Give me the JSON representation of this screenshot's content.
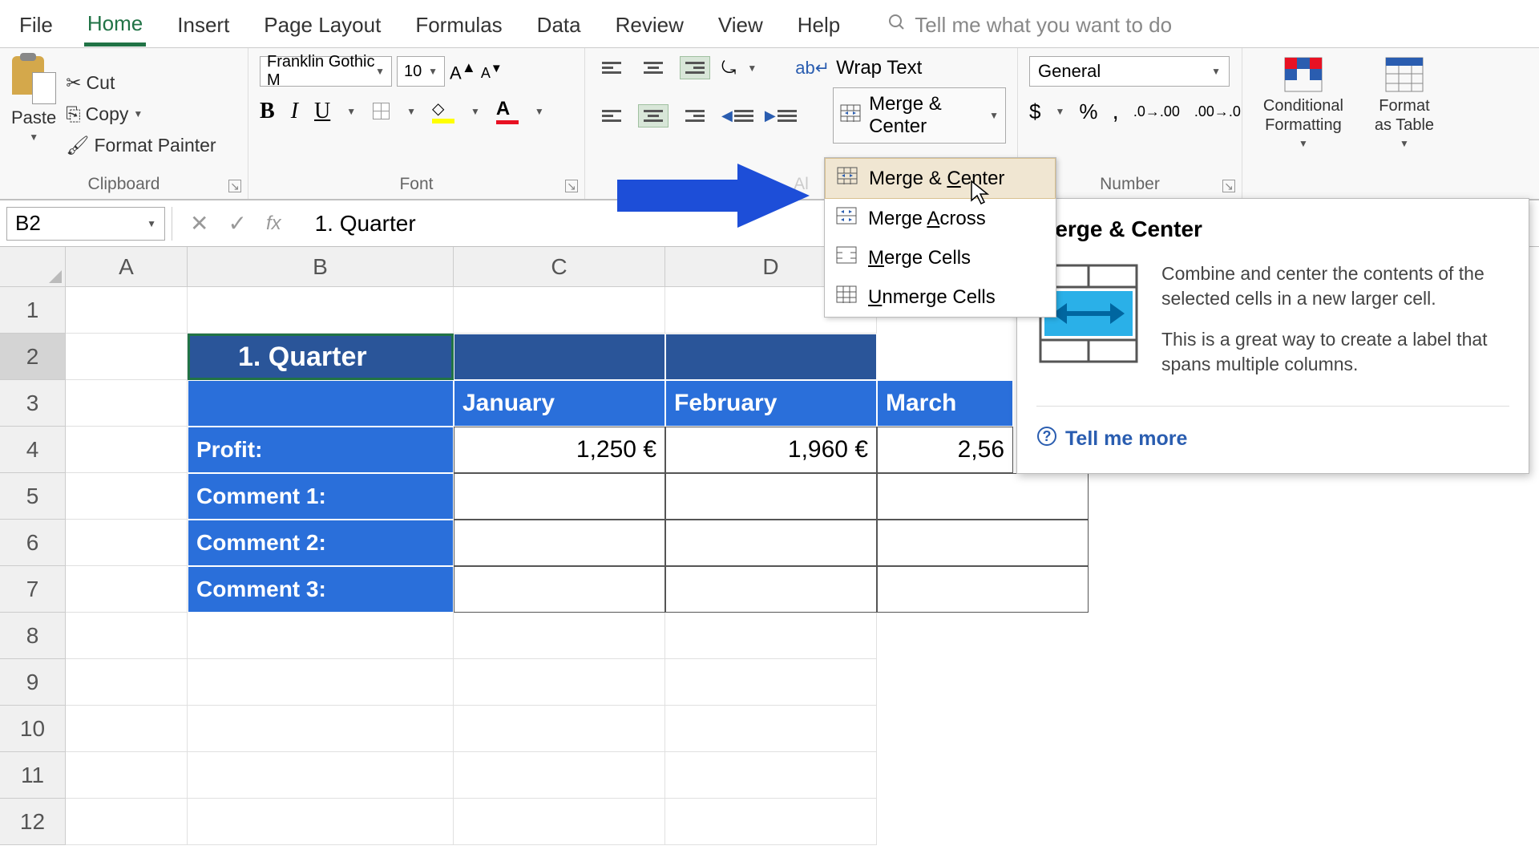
{
  "ribbon": {
    "tabs": [
      "File",
      "Home",
      "Insert",
      "Page Layout",
      "Formulas",
      "Data",
      "Review",
      "View",
      "Help"
    ],
    "active_tab": "Home",
    "search_placeholder": "Tell me what you want to do"
  },
  "clipboard": {
    "paste": "Paste",
    "cut": "Cut",
    "copy": "Copy",
    "format_painter": "Format Painter",
    "group_label": "Clipboard"
  },
  "font": {
    "name": "Franklin Gothic M",
    "size": "10",
    "group_label": "Font"
  },
  "alignment": {
    "wrap": "Wrap Text",
    "merge": "Merge & Center",
    "group_label": "Alignment"
  },
  "number": {
    "format": "General",
    "group_label": "Number"
  },
  "styles": {
    "conditional": "Conditional Formatting",
    "format_table": "Format as Table"
  },
  "merge_menu": {
    "items": [
      {
        "label": "Merge & ",
        "accel": "C",
        "rest": "enter"
      },
      {
        "label": "Merge ",
        "accel": "A",
        "rest": "cross"
      },
      {
        "label": "",
        "accel": "M",
        "rest": "erge Cells"
      },
      {
        "label": "",
        "accel": "U",
        "rest": "nmerge Cells"
      }
    ]
  },
  "tooltip": {
    "title": "Merge & Center",
    "p1": "Combine and center the contents of the selected cells in a new larger cell.",
    "p2": "This is a great way to create a label that spans multiple columns.",
    "tell_more": "Tell me more"
  },
  "formula_bar": {
    "name_box": "B2",
    "content": "1. Quarter"
  },
  "sheet": {
    "cols": [
      "A",
      "B",
      "C",
      "D"
    ],
    "rows": [
      "1",
      "2",
      "3",
      "4",
      "5",
      "6",
      "7",
      "8",
      "9",
      "10",
      "11",
      "12"
    ],
    "b2": "1. Quarter",
    "months": {
      "c3": "January",
      "d3": "February",
      "e3": "March"
    },
    "labels": {
      "b4": "Profit:",
      "b5": "Comment 1:",
      "b6": "Comment 2:",
      "b7": "Comment 3:"
    },
    "values": {
      "c4": "1,250 €",
      "d4": "1,960 €",
      "e4": "2,56"
    }
  }
}
